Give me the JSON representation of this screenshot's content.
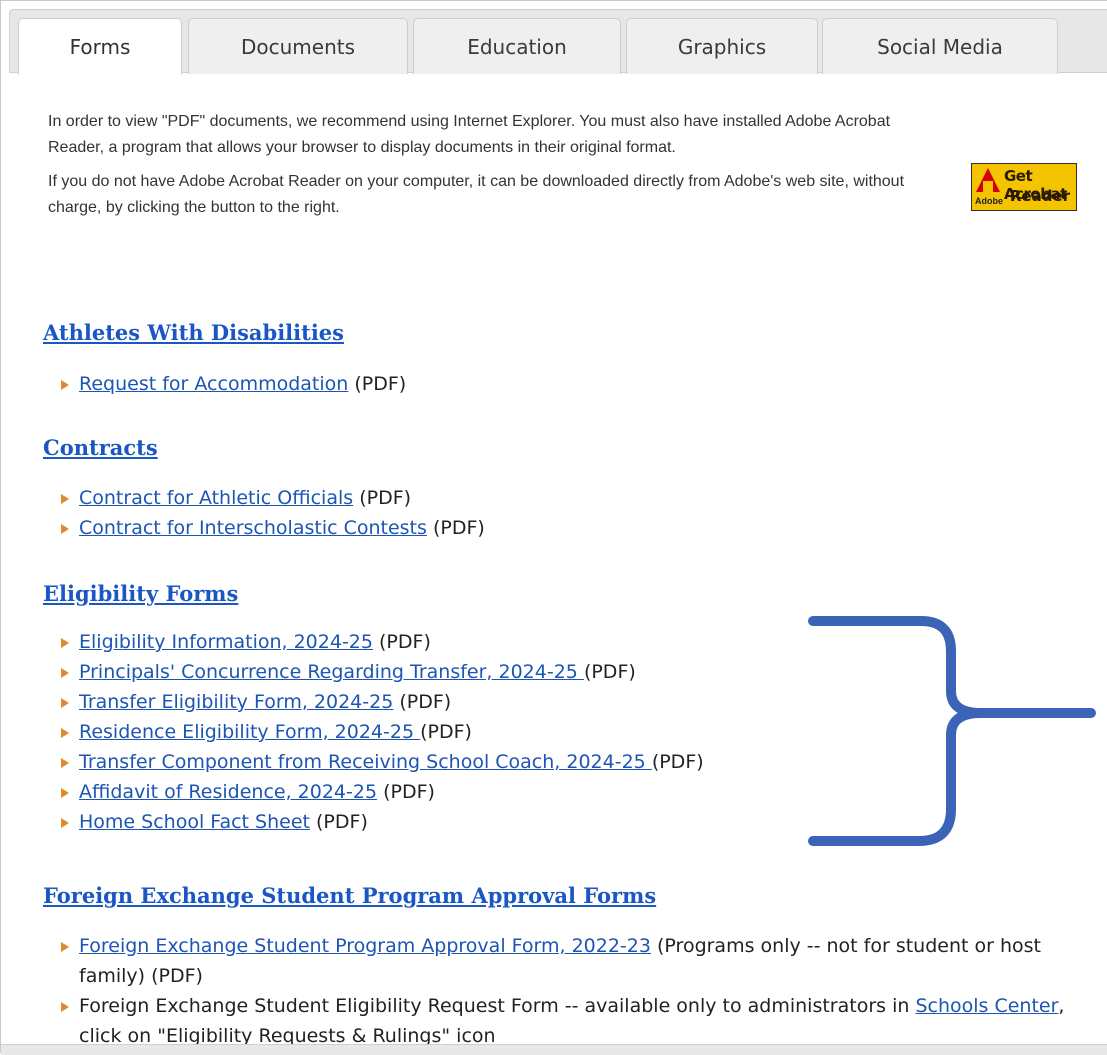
{
  "tabs": [
    {
      "label": "Forms"
    },
    {
      "label": "Documents"
    },
    {
      "label": "Education"
    },
    {
      "label": "Graphics"
    },
    {
      "label": "Social Media"
    }
  ],
  "intro": {
    "para1": "In order to view \"PDF\" documents, we recommend using Internet Explorer. You must also have installed Adobe Acrobat Reader, a program that allows your browser to display documents in their original format.",
    "para2": "If you do not have Adobe Acrobat Reader on your computer, it can be downloaded directly from Adobe's web site, without charge, by clicking the button to the right."
  },
  "acrobat_button": {
    "line1": "Get Acrobat",
    "line2": "Reader",
    "brand": "Adobe"
  },
  "sections": [
    {
      "title": "Athletes With Disabilities",
      "items": [
        {
          "link": "Request for Accommodation",
          "suffix": " (PDF)"
        }
      ]
    },
    {
      "title": "Contracts",
      "items": [
        {
          "link": "Contract for Athletic Officials",
          "suffix": " (PDF)"
        },
        {
          "link": "Contract for Interscholastic Contests",
          "suffix": " (PDF)"
        }
      ]
    },
    {
      "title": "Eligibility Forms",
      "items": [
        {
          "link": "Eligibility Information, 2024-25",
          "suffix": " (PDF)"
        },
        {
          "link": "Principals' Concurrence Regarding Transfer, 2024-25 ",
          "suffix": "(PDF)"
        },
        {
          "link": "Transfer Eligibility Form, 2024-25",
          "suffix": " (PDF)"
        },
        {
          "link": "Residence Eligibility Form, 2024-25 ",
          "suffix": "(PDF)"
        },
        {
          "link": "Transfer Component from Receiving School Coach, 2024-25 ",
          "suffix": "(PDF)"
        },
        {
          "link": "Affidavit of Residence, 2024-25",
          "suffix": " (PDF)"
        },
        {
          "link": "Home School Fact Sheet",
          "suffix": " (PDF)"
        }
      ]
    },
    {
      "title": "Foreign Exchange Student Program Approval Forms",
      "items": [
        {
          "link": "Foreign Exchange Student Program Approval Form, 2022-23",
          "suffix": " (Programs only -- not for student or host family) (PDF)"
        },
        {
          "prefix": "Foreign Exchange Student Eligibility Request Form -- available only to administrators in ",
          "link": "Schools Center",
          "suffix": ", click on \"Eligibility Requests & Rulings\" icon"
        }
      ]
    }
  ],
  "colors": {
    "link": "#1d55b3",
    "heading": "#1a56c4",
    "bullet": "#e08a2e",
    "annotation": "#3b63b8"
  },
  "annotation": {
    "icon": "curly-brace-annotation"
  }
}
